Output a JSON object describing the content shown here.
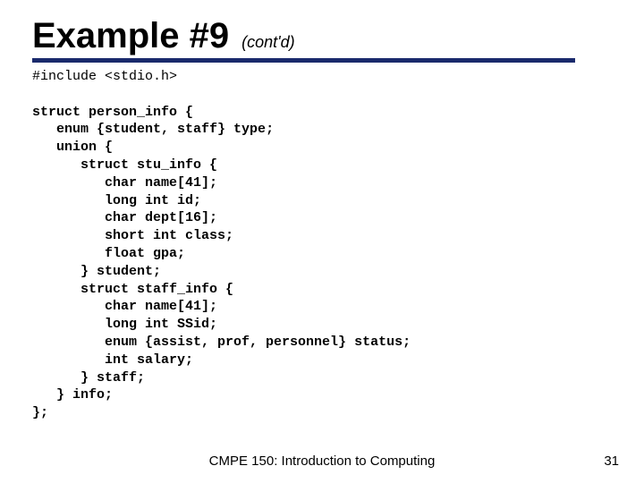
{
  "title": {
    "main": "Example #9",
    "sub": "(cont'd)"
  },
  "code": {
    "l1a": "#include ",
    "l1b": "<stdio.h>",
    "l3": "struct person_info {",
    "l4a": "   enum {student, staff} ",
    "l4b": "type",
    "l4c": ";",
    "l5": "   union {",
    "l6": "      struct stu_info {",
    "l7": "         char name[41];",
    "l8": "         long int id;",
    "l9": "         char dept[16];",
    "l10": "         short int class;",
    "l11": "         float gpa;",
    "l12a": "      } ",
    "l12b": "student",
    "l12c": ";",
    "l13": "      struct staff_info {",
    "l14": "         char name[41];",
    "l15": "         long int SSid;",
    "l16a": "         enum {assist, prof, personnel} ",
    "l16b": "status",
    "l16c": ";",
    "l17": "         int salary;",
    "l18a": "      } ",
    "l18b": "staff",
    "l18c": ";",
    "l19a": "   } ",
    "l19b": "info",
    "l19c": ";",
    "l20": "};"
  },
  "footer": {
    "course": "CMPE 150: Introduction to Computing",
    "page": "31"
  }
}
